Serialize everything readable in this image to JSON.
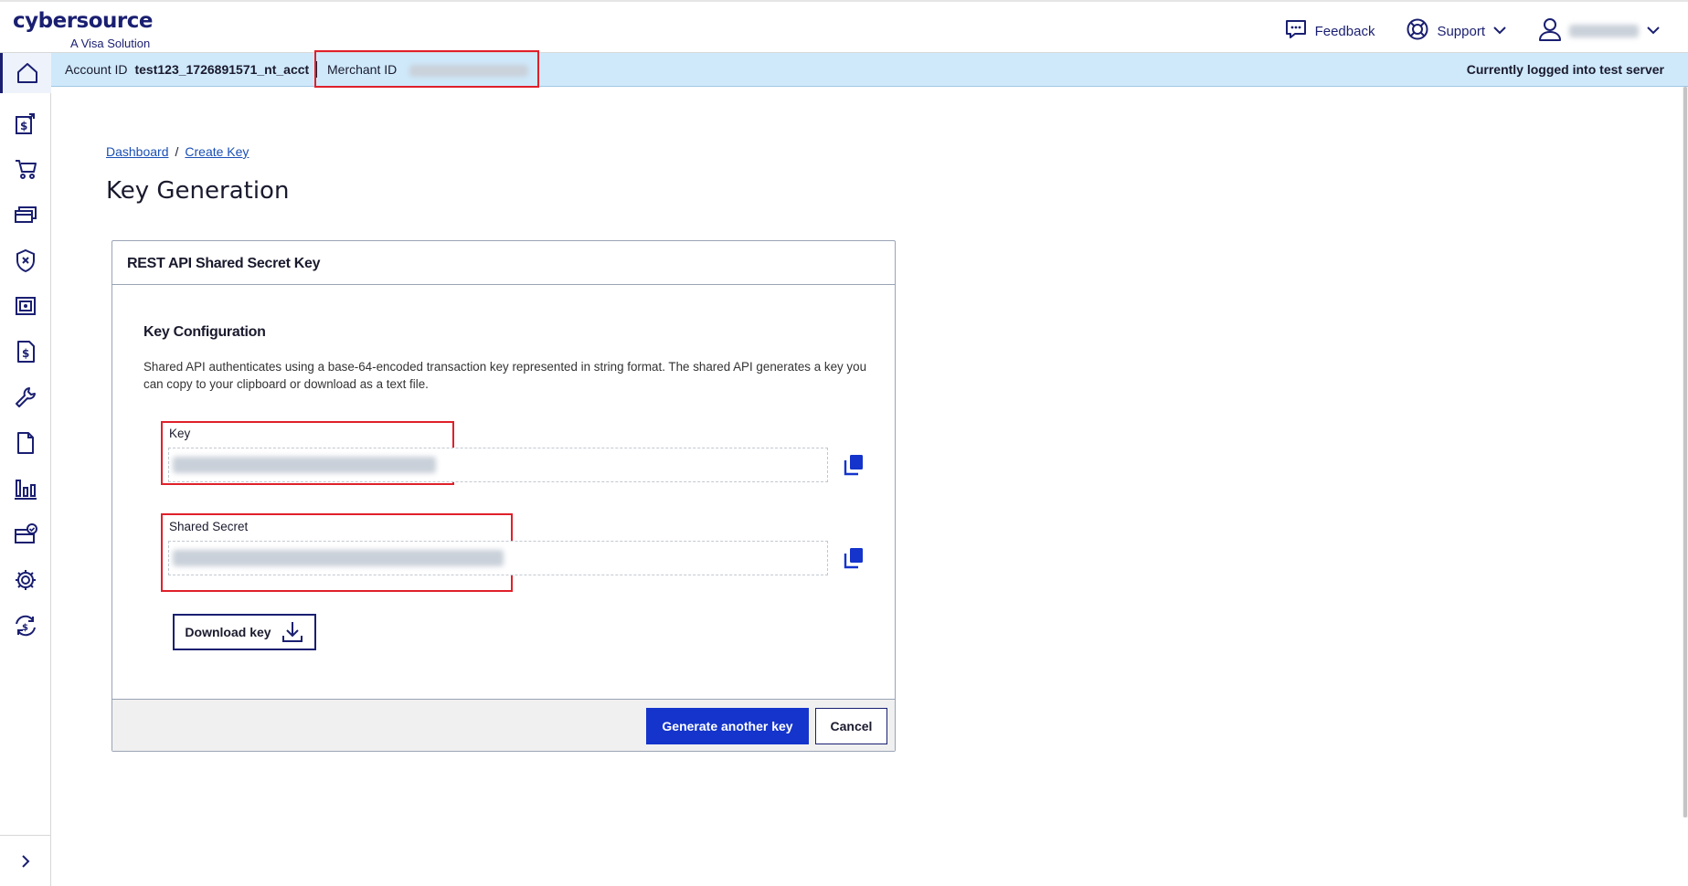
{
  "header": {
    "brand": "cybersource",
    "tagline": "A Visa Solution",
    "feedback_label": "Feedback",
    "support_label": "Support"
  },
  "account_bar": {
    "account_id_label": "Account ID",
    "account_id_value": "test123_1726891571_nt_acct",
    "merchant_id_label": "Merchant ID",
    "login_status": "Currently logged into test server"
  },
  "breadcrumb": {
    "items": [
      "Dashboard",
      "Create Key"
    ],
    "separator": "/"
  },
  "page": {
    "title": "Key Generation"
  },
  "card": {
    "title": "REST API Shared Secret Key",
    "section_title": "Key Configuration",
    "description": "Shared API authenticates using a base-64-encoded transaction key represented in string format. The shared API generates a key you can copy to your clipboard or download as a text file.",
    "key_label": "Key",
    "shared_secret_label": "Shared Secret",
    "download_label": "Download key",
    "generate_label": "Generate another key",
    "cancel_label": "Cancel"
  },
  "sidebar": {
    "items": [
      "home-icon",
      "payment-upload-icon",
      "cart-icon",
      "cards-icon",
      "shield-icon",
      "safe-icon",
      "invoice-dollar-icon",
      "wrench-icon",
      "document-icon",
      "bar-chart-icon",
      "card-check-icon",
      "gear-icon",
      "sync-money-icon"
    ]
  },
  "colors": {
    "brand_navy": "#1a1f71",
    "primary_button": "#1434cb",
    "account_bar_bg": "#cfe9fb",
    "highlight_red": "#e0202a",
    "link": "#1a4fb5"
  }
}
